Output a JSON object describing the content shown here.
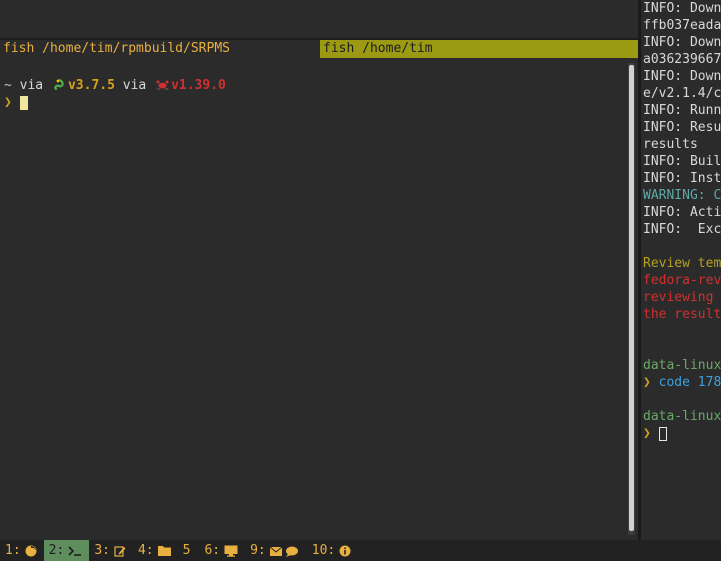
{
  "top_pane": {
    "lines": []
  },
  "tabs": [
    {
      "label": "fish /home/tim/rpmbuild/SRPMS",
      "active": false
    },
    {
      "label": "fish /home/tim",
      "active": true
    }
  ],
  "left_pane": {
    "prompt_line": {
      "tilde": "~",
      "via1": "via",
      "python_version": "v3.7.5",
      "via2": "via",
      "rust_version": "v1.39.0"
    },
    "input_arrow": "❯"
  },
  "right_pane": {
    "lines": [
      {
        "text": "INFO: Down",
        "style": "info"
      },
      {
        "text": "ffb037eada",
        "style": "info"
      },
      {
        "text": "INFO: Down",
        "style": "info"
      },
      {
        "text": "a036239667",
        "style": "info"
      },
      {
        "text": "INFO: Down",
        "style": "info"
      },
      {
        "text": "e/v2.1.4/c",
        "style": "info"
      },
      {
        "text": "INFO: Runn",
        "style": "info"
      },
      {
        "text": "INFO: Resu",
        "style": "info"
      },
      {
        "text": "results",
        "style": "info"
      },
      {
        "text": "INFO: Buil",
        "style": "info"
      },
      {
        "text": "INFO: Inst",
        "style": "info"
      },
      {
        "text": "WARNING: C",
        "style": "warn"
      },
      {
        "text": "INFO: Acti",
        "style": "info"
      },
      {
        "text": "INFO:  Exc",
        "style": "info"
      },
      {
        "text": "",
        "style": "info"
      },
      {
        "text": "Review tem",
        "style": "yellow"
      },
      {
        "text": "fedora-rev",
        "style": "red"
      },
      {
        "text": "reviewing ",
        "style": "red"
      },
      {
        "text": "the result",
        "style": "red"
      },
      {
        "text": "",
        "style": "info"
      },
      {
        "text": "",
        "style": "info"
      },
      {
        "text": "data-linux",
        "style": "green"
      }
    ],
    "cmd_line": {
      "arrow": "❯",
      "cmd": "code",
      "arg": "178"
    },
    "prompt2": "data-linux",
    "arrow2": "❯"
  },
  "statusbar": {
    "workspaces": [
      {
        "num": "1:",
        "icon": "firefox-icon",
        "active": false
      },
      {
        "num": "2:",
        "icon": "terminal-icon",
        "active": true
      },
      {
        "num": "3:",
        "icon": "edit-icon",
        "active": false
      },
      {
        "num": "4:",
        "icon": "folder-icon",
        "active": false
      },
      {
        "num": "5",
        "icon": "",
        "active": false
      },
      {
        "num": "6:",
        "icon": "monitor-icon",
        "active": false
      },
      {
        "num": "9:",
        "icon": "mail-chat-icon",
        "active": false
      },
      {
        "num": "10:",
        "icon": "info-icon",
        "active": false
      }
    ]
  },
  "colors": {
    "active_tab": "#9c9a12",
    "active_workspace": "#5e8d5e",
    "accent": "#e8b040"
  }
}
